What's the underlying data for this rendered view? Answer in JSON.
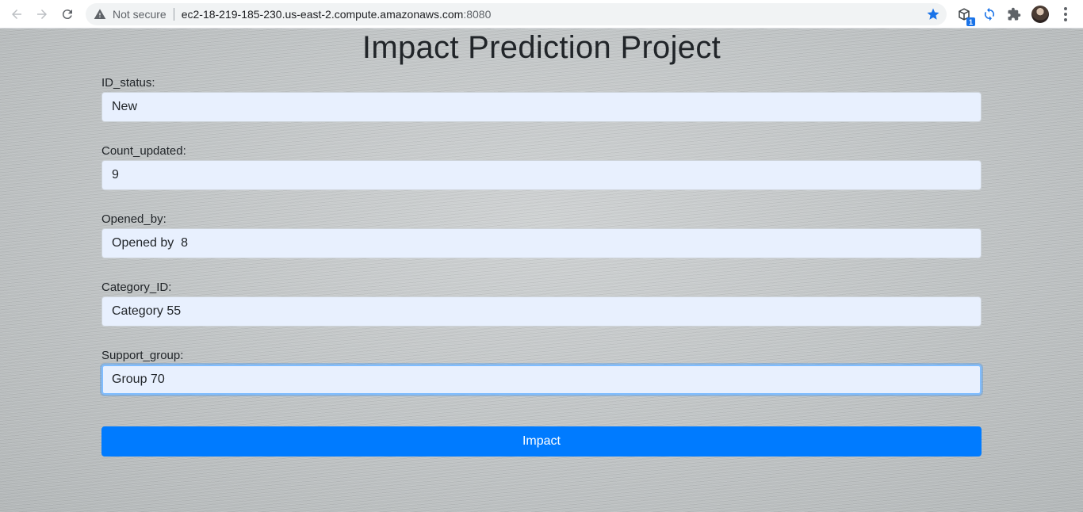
{
  "browser": {
    "security_text": "Not secure",
    "url_host": "ec2-18-219-185-230.us-east-2.compute.amazonaws.com",
    "url_port": ":8080",
    "extension_badge": "1",
    "icons": [
      "back-arrow-icon",
      "forward-arrow-icon",
      "reload-icon",
      "warning-icon",
      "star-icon",
      "extension-icon",
      "sync-icon",
      "puzzle-icon",
      "avatar",
      "menu-dots-icon"
    ],
    "accent_color": "#1a73e8"
  },
  "page": {
    "title": "Impact Prediction Project",
    "fields": [
      {
        "label": "ID_status:",
        "value": "New"
      },
      {
        "label": "Count_updated:",
        "value": "9"
      },
      {
        "label": "Opened_by:",
        "value": "Opened by  8"
      },
      {
        "label": "Category_ID:",
        "value": "Category 55"
      },
      {
        "label": "Support_group:",
        "value": "Group 70"
      }
    ],
    "submit_label": "Impact",
    "button_color": "#007bff",
    "input_bg_color": "#e8f0fe"
  }
}
